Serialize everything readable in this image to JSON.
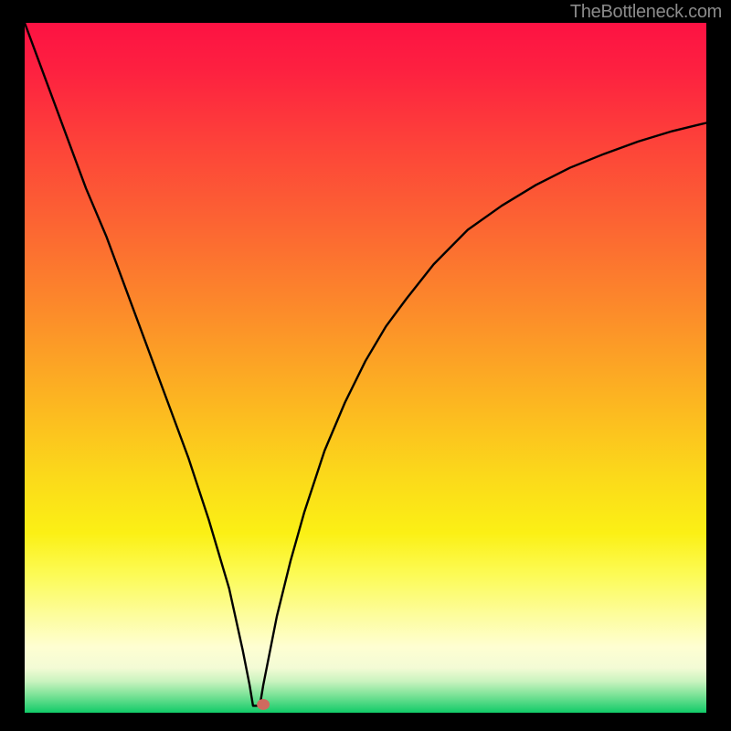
{
  "attribution": "TheBottleneck.com",
  "chart_data": {
    "type": "line",
    "title": "",
    "xlabel": "",
    "ylabel": "",
    "xlim": [
      0,
      100
    ],
    "ylim": [
      0,
      100
    ],
    "series": [
      {
        "name": "curve",
        "x": [
          0,
          3,
          6,
          9,
          12,
          15,
          18,
          21,
          24,
          27,
          30,
          32,
          33,
          33.5,
          34.5,
          35,
          36,
          37,
          39,
          41,
          44,
          47,
          50,
          53,
          56,
          60,
          65,
          70,
          75,
          80,
          85,
          90,
          95,
          100
        ],
        "values": [
          100,
          92,
          84,
          76,
          69,
          61,
          53,
          45,
          37,
          28,
          18,
          9,
          4,
          1,
          1,
          4,
          9,
          14,
          22,
          29,
          38,
          45,
          51,
          56,
          60,
          65,
          70,
          73.5,
          76.5,
          79,
          81,
          82.8,
          84.3,
          85.5
        ]
      }
    ],
    "marker": {
      "x": 35,
      "y": 1.2,
      "color": "#cf6a5f"
    },
    "background_gradient": {
      "stops": [
        {
          "offset": 0.0,
          "color": "#fd1243"
        },
        {
          "offset": 0.07,
          "color": "#fd2140"
        },
        {
          "offset": 0.18,
          "color": "#fd4439"
        },
        {
          "offset": 0.3,
          "color": "#fc6732"
        },
        {
          "offset": 0.42,
          "color": "#fc8c2a"
        },
        {
          "offset": 0.55,
          "color": "#fcb621"
        },
        {
          "offset": 0.66,
          "color": "#fbda1a"
        },
        {
          "offset": 0.74,
          "color": "#fbf015"
        },
        {
          "offset": 0.8,
          "color": "#fcfb56"
        },
        {
          "offset": 0.86,
          "color": "#fdfd9e"
        },
        {
          "offset": 0.905,
          "color": "#fefed2"
        },
        {
          "offset": 0.935,
          "color": "#f3fbd5"
        },
        {
          "offset": 0.955,
          "color": "#c8f3be"
        },
        {
          "offset": 0.975,
          "color": "#7ae296"
        },
        {
          "offset": 1.0,
          "color": "#11cb68"
        }
      ]
    },
    "frame": {
      "stroke": "#000000",
      "width_top": 25,
      "width_side": 27,
      "width_bottom": 20
    }
  }
}
